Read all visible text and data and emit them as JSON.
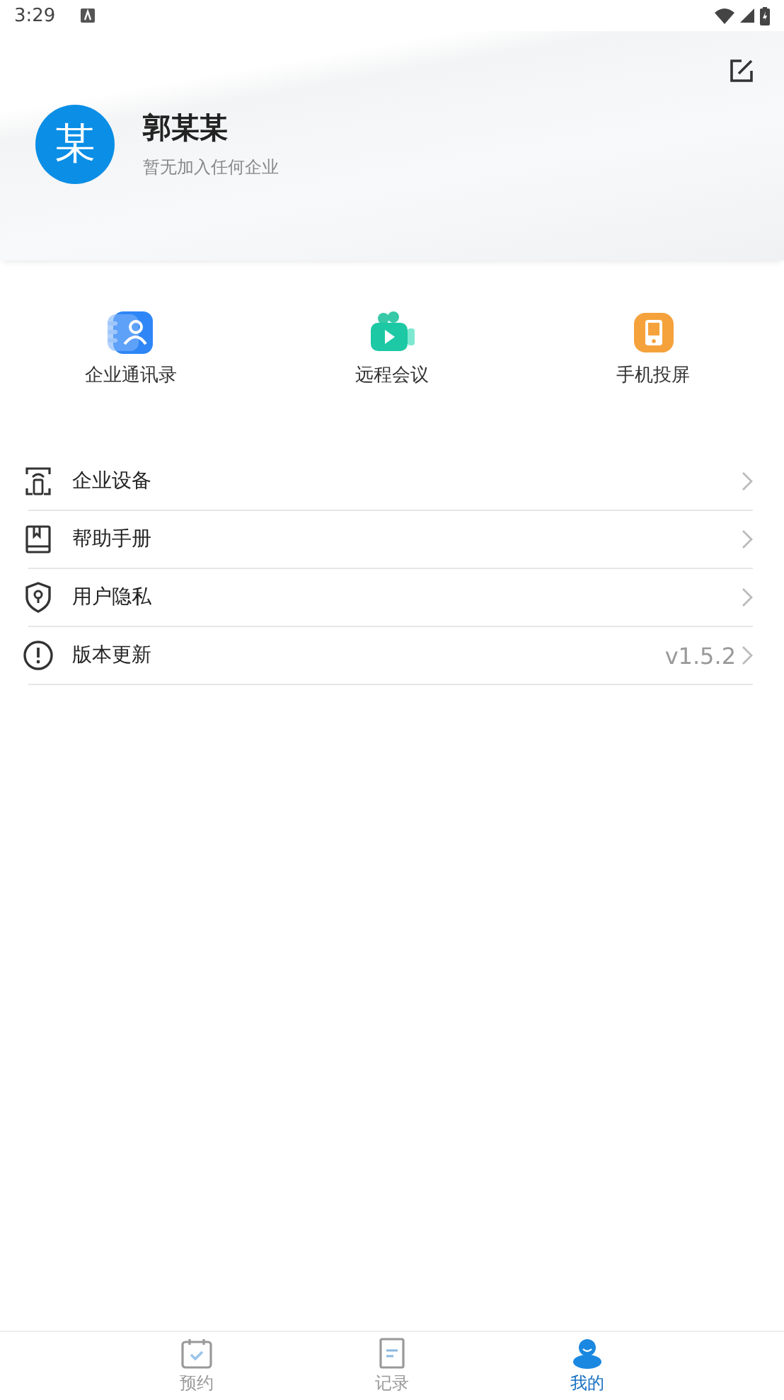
{
  "status_bar": {
    "time": "3:29"
  },
  "profile": {
    "avatar": "某",
    "name": "郭某某",
    "subtitle": "暂无加入任何企业"
  },
  "shortcuts": [
    {
      "label": "企业通讯录"
    },
    {
      "label": "远程会议"
    },
    {
      "label": "手机投屏"
    }
  ],
  "menu": [
    {
      "label": "企业设备"
    },
    {
      "label": "帮助手册"
    },
    {
      "label": "用户隐私"
    },
    {
      "label": "版本更新",
      "value": "v1.5.2"
    }
  ],
  "tabs": [
    {
      "label": "预约",
      "selected": false
    },
    {
      "label": "记录",
      "selected": false
    },
    {
      "label": "我的",
      "selected": true
    }
  ]
}
